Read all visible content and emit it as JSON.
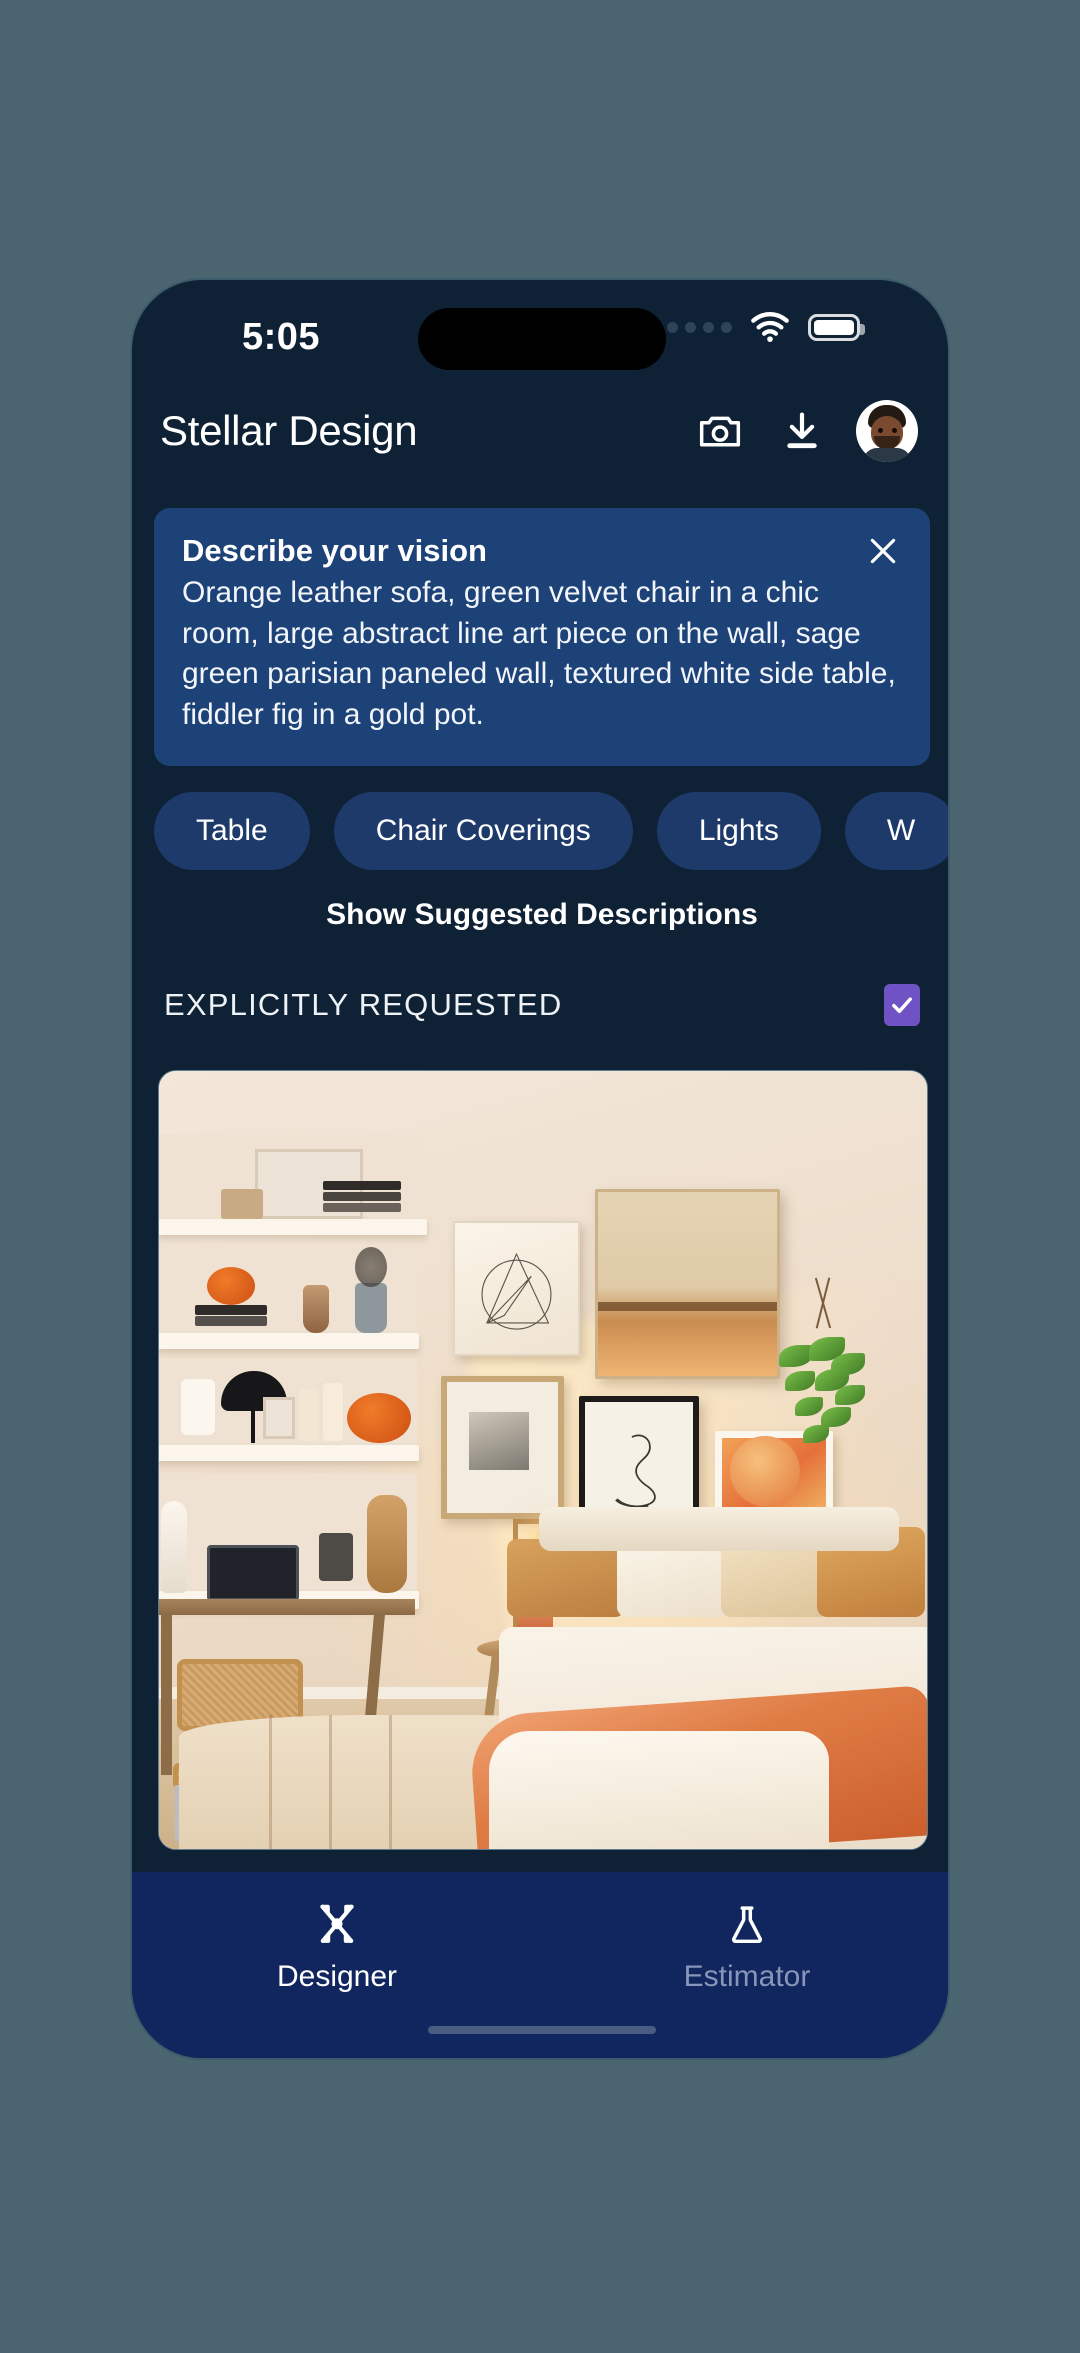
{
  "status_bar": {
    "time": "5:05",
    "cellular_icon": "cellular-dots-icon",
    "wifi_icon": "wifi-icon",
    "battery_icon": "battery-icon"
  },
  "header": {
    "title": "Stellar Design",
    "camera_icon": "camera-icon",
    "download_icon": "download-icon",
    "avatar": "user-avatar"
  },
  "vision_card": {
    "title": "Describe your vision",
    "description": "Orange leather sofa, green velvet chair in a chic room, large abstract line art piece on the wall, sage green parisian paneled wall, textured white side table, fiddler fig in a gold pot.",
    "close_icon": "close-icon",
    "background_color": "#1d4278"
  },
  "chips": [
    {
      "label": "Table"
    },
    {
      "label": "Chair Coverings"
    },
    {
      "label": "Lights"
    },
    {
      "label": "W"
    }
  ],
  "suggested": {
    "label": "Show Suggested Descriptions"
  },
  "explicit": {
    "label": "EXPLICITLY REQUESTED",
    "checked": true,
    "checkbox_color": "#6f52c4",
    "check_icon": "checkmark-icon"
  },
  "room_image": {
    "alt": "Styled bedroom with gallery wall, desk, shelves and bed"
  },
  "tabbar": {
    "background_color": "#11265e",
    "items": [
      {
        "label": "Designer",
        "icon": "crossed-tools-icon",
        "active": true
      },
      {
        "label": "Estimator",
        "icon": "flask-icon",
        "active": false
      }
    ]
  },
  "colors": {
    "page_background": "#4a6570",
    "app_background": "#0f2135",
    "chip_background": "#1d3a6b",
    "accent_purple": "#6f52c4"
  }
}
